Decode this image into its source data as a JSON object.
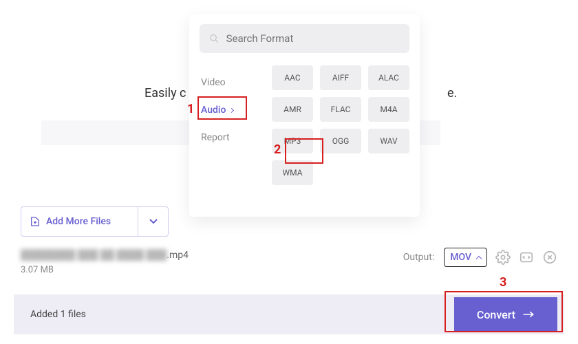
{
  "hero": {
    "left_text": "Easily c",
    "right_text": "e."
  },
  "search": {
    "placeholder": "Search Format"
  },
  "categories": {
    "video": "Video",
    "audio": "Audio",
    "report": "Report"
  },
  "formats": {
    "aac": "AAC",
    "aiff": "AIFF",
    "alac": "ALAC",
    "amr": "AMR",
    "flac": "FLAC",
    "m4a": "M4A",
    "mp3": "MP3",
    "ogg": "OGG",
    "wav": "WAV",
    "wma": "WMA"
  },
  "annotations": {
    "n1": "1",
    "n2": "2",
    "n3": "3"
  },
  "add_more": {
    "label": "Add More Files"
  },
  "file": {
    "name_blur": "████████ ███ ██ ████ ███",
    "ext": ".mp4",
    "size": "3.07 MB"
  },
  "output": {
    "label": "Output:",
    "value": "MOV"
  },
  "bottom": {
    "added_text": "Added 1 files",
    "convert": "Convert"
  }
}
